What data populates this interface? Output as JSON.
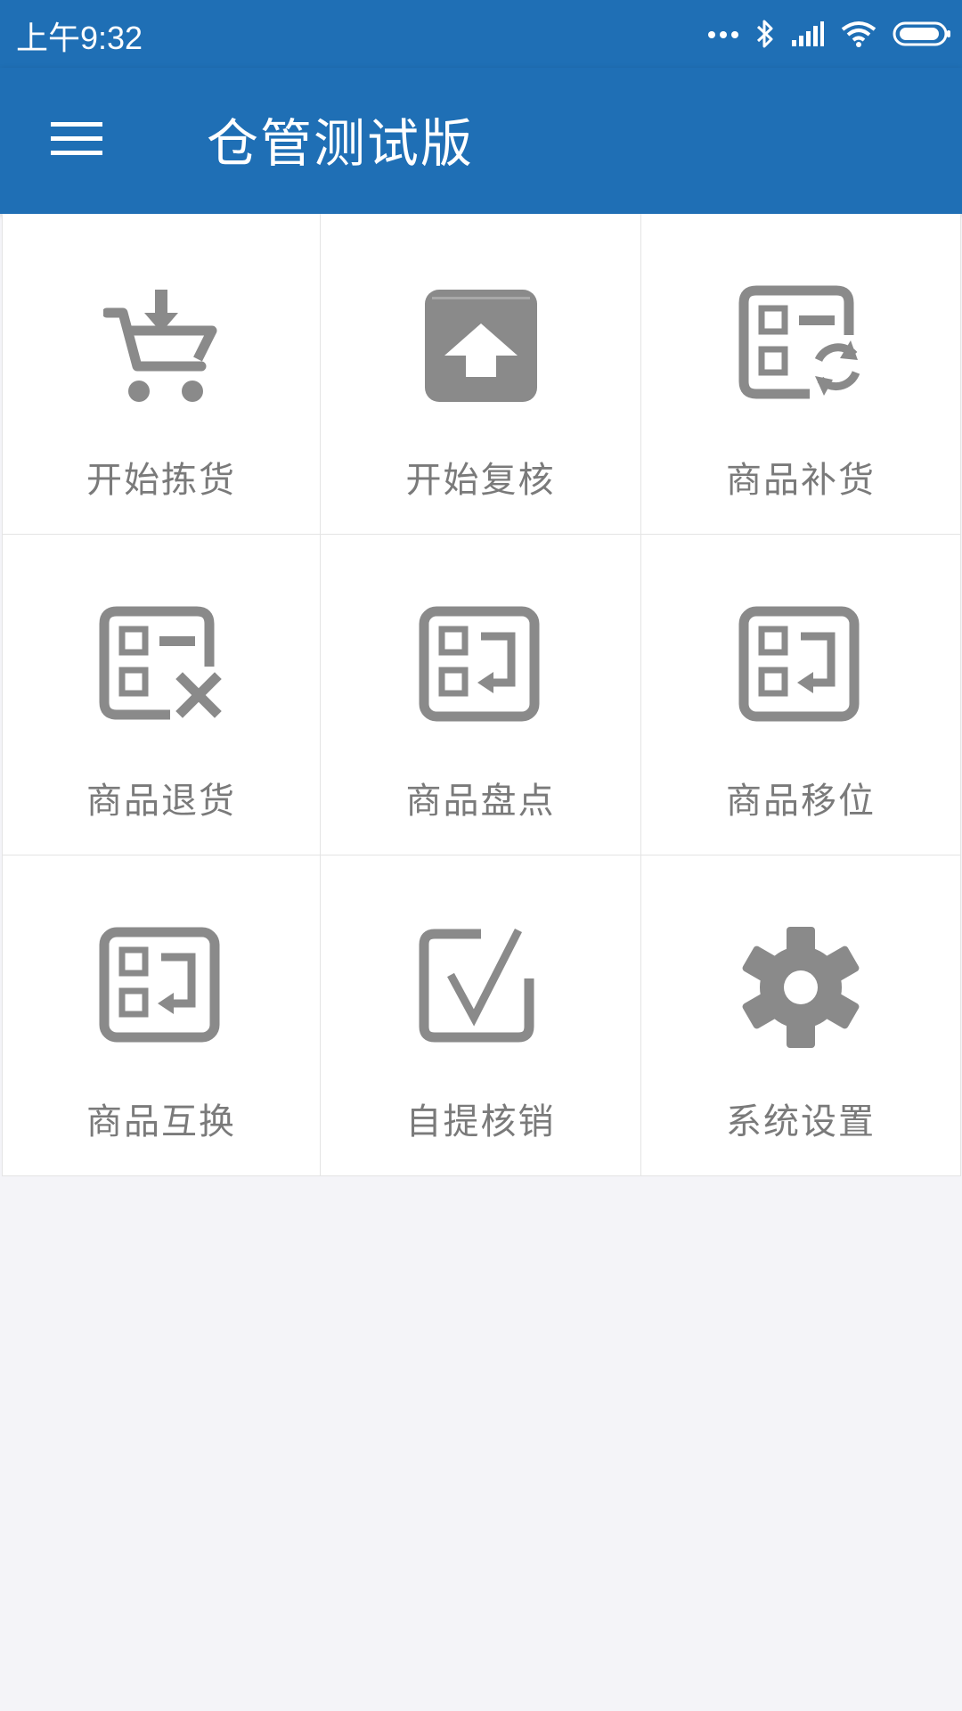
{
  "status_bar": {
    "time": "上午9:32",
    "icons": [
      "more-dots-icon",
      "bluetooth-icon",
      "signal-icon",
      "wifi-icon",
      "battery-icon"
    ]
  },
  "app_bar": {
    "title": "仓管测试版",
    "menu_icon": "menu-icon"
  },
  "colors": {
    "primary": "#1f6fb5",
    "icon_gray": "#8a8a8a",
    "label_gray": "#7a7a7a",
    "background": "#f4f4f8"
  },
  "menu_grid": [
    {
      "label": "开始拣货",
      "icon": "cart-download-icon"
    },
    {
      "label": "开始复核",
      "icon": "box-upload-icon"
    },
    {
      "label": "商品补货",
      "icon": "list-refresh-icon"
    },
    {
      "label": "商品退货",
      "icon": "list-remove-icon"
    },
    {
      "label": "商品盘点",
      "icon": "list-return-icon"
    },
    {
      "label": "商品移位",
      "icon": "list-return-icon"
    },
    {
      "label": "商品互换",
      "icon": "list-return-icon"
    },
    {
      "label": "自提核销",
      "icon": "checkbox-icon"
    },
    {
      "label": "系统设置",
      "icon": "gear-icon"
    }
  ]
}
